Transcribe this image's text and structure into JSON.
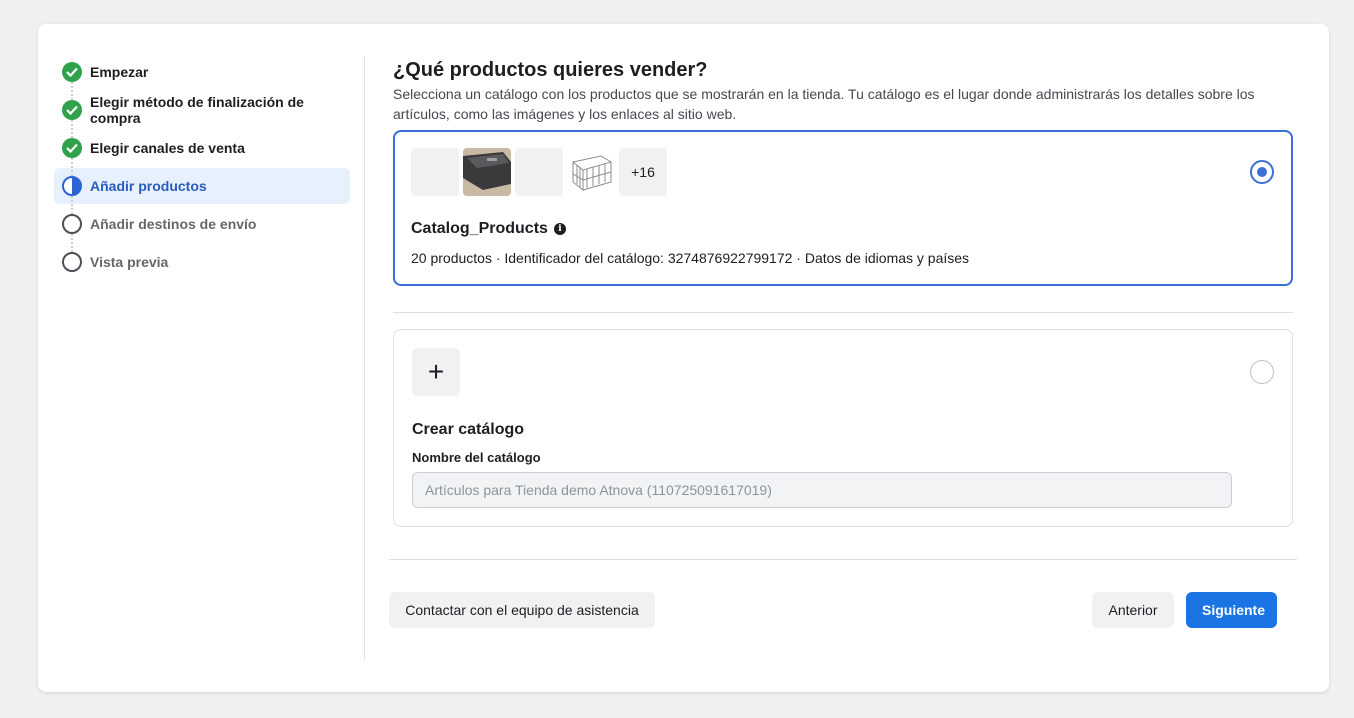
{
  "stepper": {
    "steps": [
      {
        "label": "Empezar",
        "state": "done"
      },
      {
        "label": "Elegir método de finalización de compra",
        "state": "done"
      },
      {
        "label": "Elegir canales de venta",
        "state": "done"
      },
      {
        "label": "Añadir productos",
        "state": "active"
      },
      {
        "label": "Añadir destinos de envío",
        "state": "pending"
      },
      {
        "label": "Vista previa",
        "state": "pending"
      }
    ]
  },
  "main": {
    "title": "¿Qué productos quieres vender?",
    "description": "Selecciona un catálogo con los productos que se mostrarán en la tienda. Tu catálogo es el lugar donde administrarás los detalles sobre los artículos, como las imágenes y los enlaces al sitio web."
  },
  "catalog": {
    "name": "Catalog_Products",
    "meta": "20 productos · Identificador del catálogo: 3274876922799172 · Datos de idiomas y países",
    "more_count": "+16",
    "selected": true
  },
  "create": {
    "title": "Crear catálogo",
    "field_label": "Nombre del catálogo",
    "field_placeholder": "Artículos para Tienda demo Atnova (110725091617019)"
  },
  "footer": {
    "support_label": "Contactar con el equipo de asistencia",
    "prev_label": "Anterior",
    "next_label": "Siguiente"
  },
  "colors": {
    "done": "#31a24c",
    "accent": "#1b74e4",
    "selected_border": "#3b6ed6"
  }
}
